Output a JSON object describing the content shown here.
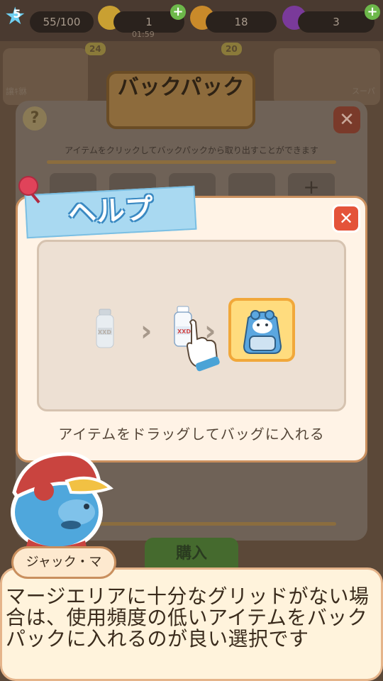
{
  "hud": {
    "level": "5",
    "energy": "55/100",
    "bolts": "1",
    "timer": "01:59",
    "coins": "18",
    "gems": "3"
  },
  "shop": {
    "badge_left": "24",
    "badge_right": "20",
    "label_left": "讓ｷ貅",
    "label_right": "スーパ"
  },
  "backpack": {
    "title": "バックパック",
    "instruction": "アイテムをクリックしてバックパックから取り出すことができます",
    "add_slot": "+",
    "buy_label": "購入"
  },
  "help": {
    "title": "ヘルプ",
    "caption": "アイテムをドラッグしてバッグに入れる",
    "bottle_label": "XXD",
    "close_icon": "close-icon"
  },
  "dialogue": {
    "speaker": "ジャック・マ",
    "text": "マージエリアに十分なグリッドがない場合は、使用頻度の低いアイテムをバックパックに入れるのが良い選択です"
  },
  "colors": {
    "help_banner": "#a9d9f1",
    "close_button": "#e4533a",
    "bag_highlight": "#ffdc7e"
  }
}
